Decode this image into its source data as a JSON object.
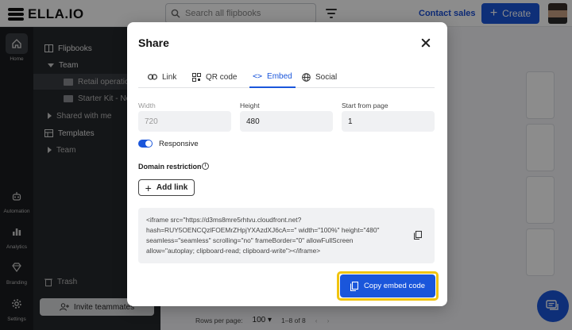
{
  "app": {
    "logo_text": "ELLA.IO"
  },
  "header": {
    "search_placeholder": "Search all flipbooks",
    "contact_label": "Contact sales",
    "create_label": "Create"
  },
  "rail": [
    {
      "label": "Home",
      "icon": "home-icon"
    },
    {
      "label": "Automation",
      "icon": "robot-icon"
    },
    {
      "label": "Analytics",
      "icon": "bar-chart-icon"
    },
    {
      "label": "Branding",
      "icon": "diamond-icon"
    },
    {
      "label": "Settings",
      "icon": "gear-icon"
    }
  ],
  "sidebar": {
    "flipbooks_label": "Flipbooks",
    "team_label": "Team",
    "folders": [
      "Retail operation",
      "Starter Kit - New"
    ],
    "shared_label": "Shared with me",
    "templates_label": "Templates",
    "templates_team_label": "Team",
    "trash_label": "Trash",
    "invite_label": "Invite teammates"
  },
  "pagination": {
    "rows_label": "Rows per page:",
    "rows_value": "100",
    "range": "1–8 of 8"
  },
  "modal": {
    "title": "Share",
    "tabs": [
      "Link",
      "QR code",
      "Embed",
      "Social"
    ],
    "active_tab": "Embed",
    "width_label": "Width",
    "width_value": "720",
    "height_label": "Height",
    "height_value": "480",
    "start_label": "Start from page",
    "start_value": "1",
    "responsive_label": "Responsive",
    "responsive_on": true,
    "domain_label": "Domain restriction",
    "add_link_label": "Add link",
    "embed_code": [
      "<iframe src=\"https://d3ms8mre5rhtvu.cloudfront.net?",
      "hash=RUY5OENCQzlFOEMrZHpjYXAzdXJ6cA==\" width=\"100%\" height=\"480\"",
      "seamless=\"seamless\" scrolling=\"no\" frameBorder=\"0\" allowFullScreen",
      "allow=\"autoplay; clipboard-read; clipboard-write\"></iframe>"
    ],
    "copy_label": "Copy embed code"
  },
  "colors": {
    "accent": "#1a56db",
    "highlight": "#f1c40f",
    "rail": "#1b1c1f",
    "sidebar": "#26282c"
  }
}
